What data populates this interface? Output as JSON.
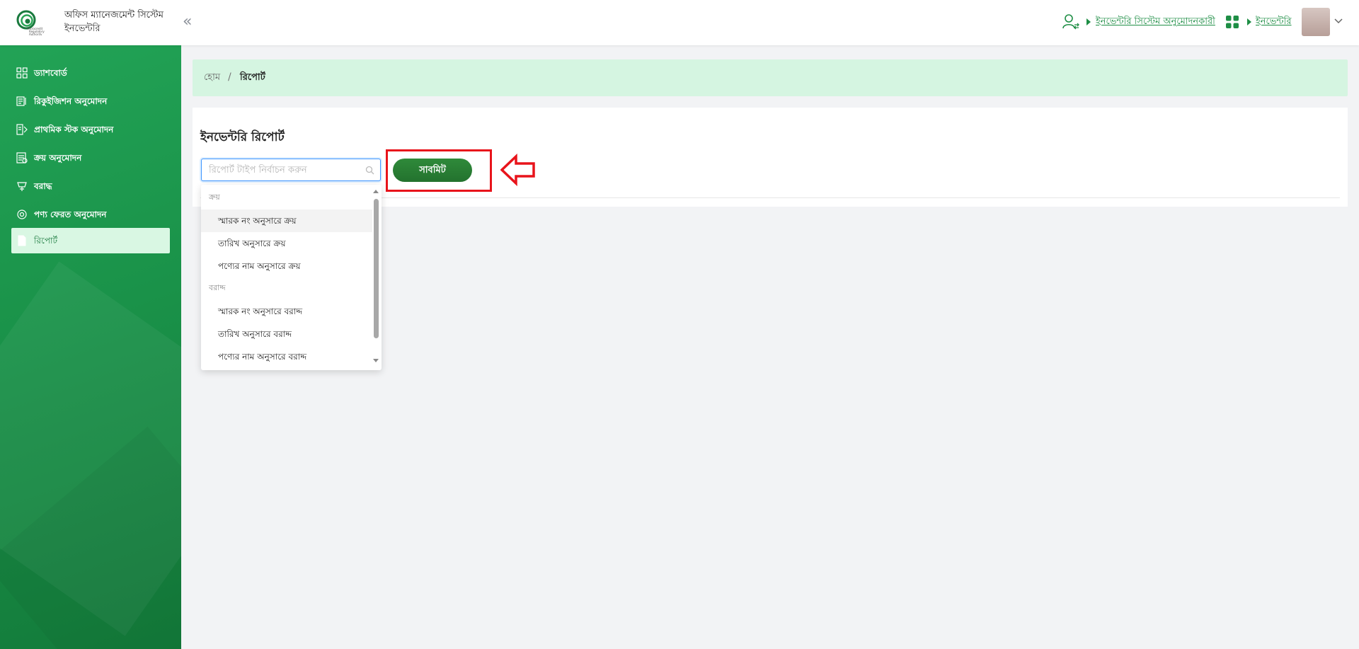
{
  "header": {
    "app_title": "অফিস ম্যানেজমেন্ট সিস্টেম",
    "app_subtitle": "ইনভেন্টরি",
    "collapse_icon": "double-chevron-left-icon",
    "role_link": "ইনভেন্টরি সিস্টেম অনুমোদনকারী",
    "module_link": "ইনভেন্টরি"
  },
  "sidebar": {
    "items": [
      {
        "label": "ড্যাশবোর্ড",
        "icon": "dashboard-icon"
      },
      {
        "label": "রিকুইজিশন অনুমোদন",
        "icon": "requisition-icon"
      },
      {
        "label": "প্রাথমিক স্টক অনুমোদন",
        "icon": "stock-icon"
      },
      {
        "label": "ক্রয় অনুমোদন",
        "icon": "purchase-icon"
      },
      {
        "label": "বরাদ্ধ",
        "icon": "allocation-icon"
      },
      {
        "label": "পণ্য ফেরত অনুমোদন",
        "icon": "return-icon"
      },
      {
        "label": "রিপোর্ট",
        "icon": "report-icon",
        "active": true
      }
    ]
  },
  "breadcrumb": {
    "home": "হোম",
    "separator": "/",
    "current": "রিপোর্ট"
  },
  "card": {
    "title": "ইনভেন্টরি রিপোর্ট",
    "select_placeholder": "রিপোর্ট টাইপ নির্বাচন করুন",
    "submit_label": "সাবমিট"
  },
  "dropdown": {
    "groups": [
      {
        "label": "ক্রয়",
        "options": [
          "স্মারক নং অনুসারে ক্রয়",
          "তারিখ অনুসারে ক্রয়",
          "পণ্যের নাম অনুসারে ক্রয়"
        ]
      },
      {
        "label": "বরাদ্দ",
        "options": [
          "স্মারক নং অনুসারে বরাদ্দ",
          "তারিখ অনুসারে বরাদ্দ",
          "পণ্যের নাম অনুসারে বরাদ্দ"
        ]
      }
    ]
  },
  "colors": {
    "brand_green": "#1e8e45",
    "active_bg": "#d9f7e3",
    "breadcrumb_bg": "#d5f5e1",
    "highlight_red": "#e8141b"
  }
}
